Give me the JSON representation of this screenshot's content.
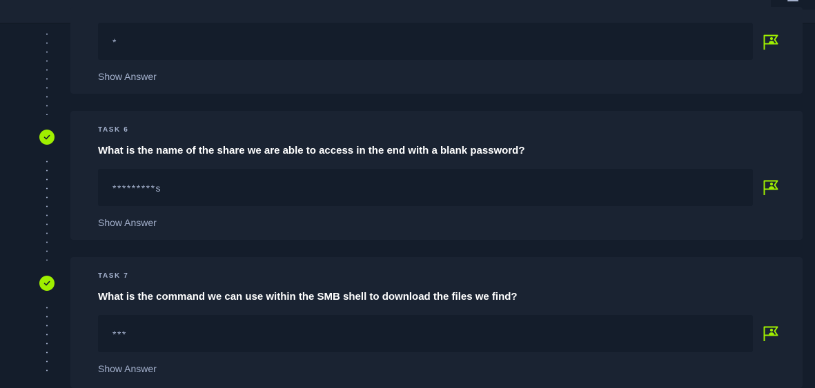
{
  "colors": {
    "background": "#141d2b",
    "card": "#1a2332",
    "accent": "#9fef00",
    "muted_text": "#a4b1cd"
  },
  "tasks": [
    {
      "label": "",
      "question": "",
      "answer_mask": "*",
      "completed": true,
      "show_answer": "Show Answer",
      "flag_icon": "submit-flag-icon"
    },
    {
      "label": "TASK 6",
      "question": "What is the name of the share we are able to access in the end with a blank password?",
      "answer_mask": "*********s",
      "completed": true,
      "show_answer": "Show Answer",
      "flag_icon": "submit-flag-icon"
    },
    {
      "label": "TASK 7",
      "question": "What is the command we can use within the SMB shell to download the files we find?",
      "answer_mask": "***",
      "completed": true,
      "show_answer": "Show Answer",
      "flag_icon": "submit-flag-icon"
    }
  ]
}
